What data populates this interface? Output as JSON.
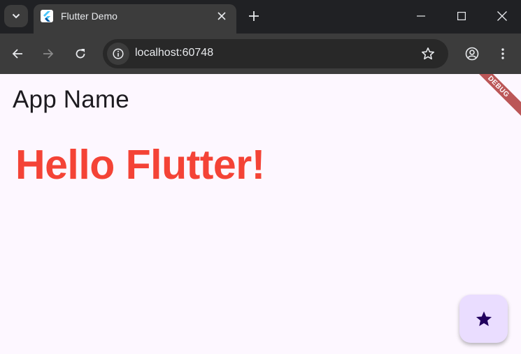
{
  "browser": {
    "tab": {
      "title": "Flutter Demo"
    },
    "address_bar": {
      "url": "localhost:60748"
    }
  },
  "app": {
    "appbar_title": "App Name",
    "headline": "Hello Flutter!",
    "debug_banner": "DEBUG",
    "fab_icon": "star-icon"
  },
  "colors": {
    "headline": "#f44336",
    "page_background": "#fdf7ff",
    "fab_background": "#eaddff",
    "fab_icon": "#21005d"
  }
}
